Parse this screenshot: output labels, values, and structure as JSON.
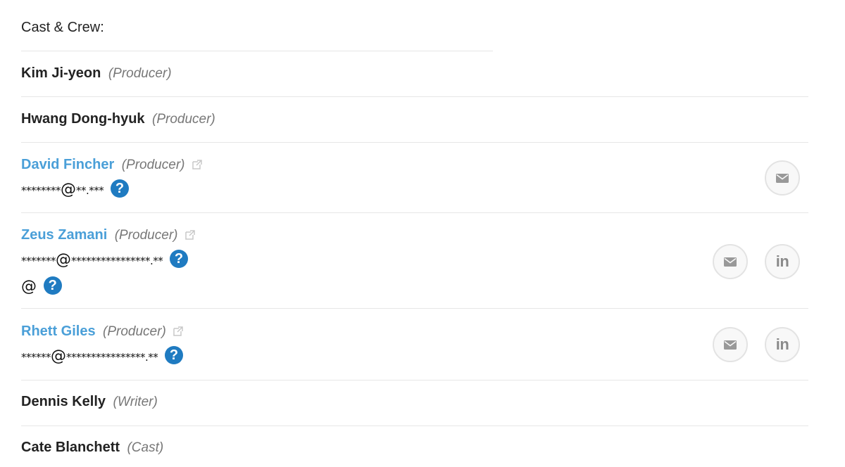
{
  "section": {
    "title": "Cast & Crew:"
  },
  "crew": [
    {
      "name": "Kim Ji-yeon",
      "role": "(Producer)"
    },
    {
      "name": "Hwang Dong-hyuk",
      "role": "(Producer)"
    },
    {
      "name": "David Fincher",
      "role": "(Producer)",
      "email": [
        "********",
        "@",
        "**.***"
      ]
    },
    {
      "name": "Zeus Zamani",
      "role": "(Producer)",
      "email": [
        "*******",
        "@",
        "****************.**"
      ],
      "extra": "@"
    },
    {
      "name": "Rhett Giles",
      "role": "(Producer)",
      "email": [
        "******",
        "@",
        "****************.**"
      ]
    },
    {
      "name": "Dennis Kelly",
      "role": "(Writer)"
    },
    {
      "name": "Cate Blanchett",
      "role": "(Cast)"
    }
  ],
  "icons": {
    "help": "?",
    "linkedin": "in"
  },
  "colors": {
    "link": "#4a9fd8",
    "help_badge": "#1f7bc1",
    "divider": "#e6e6e6",
    "role_text": "#777777"
  }
}
